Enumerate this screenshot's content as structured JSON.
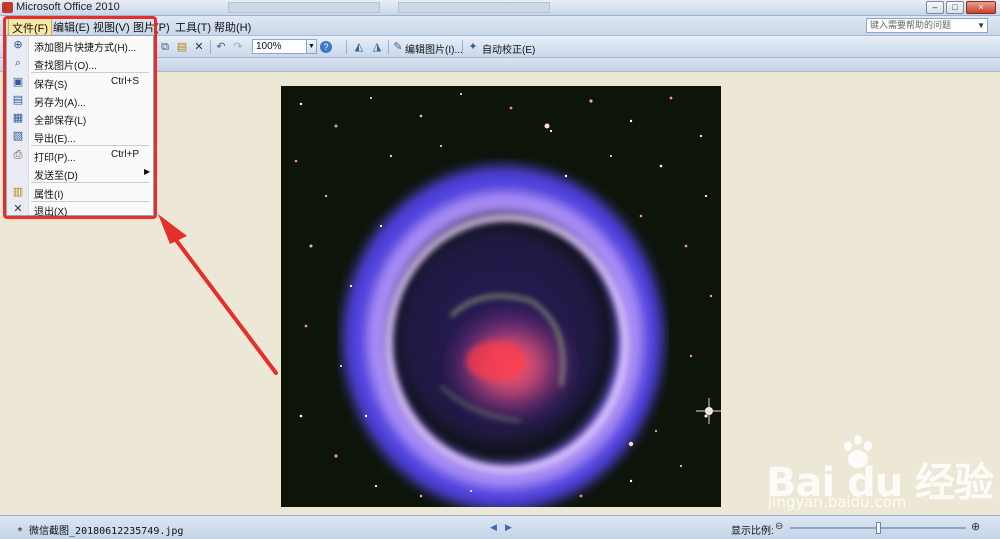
{
  "window": {
    "title": "Microsoft Office 2010",
    "background_tabs": [
      "",
      ""
    ],
    "controls": {
      "minimize": "–",
      "maximize": "□",
      "close": "×"
    }
  },
  "menubar": {
    "items": [
      "文件(F)",
      "编辑(E)",
      "视图(V)",
      "图片(P)",
      "工具(T)",
      "帮助(H)"
    ],
    "active_index": 0,
    "help_placeholder": "键入需要帮助的问题"
  },
  "toolbar": {
    "zoom_value": "100%",
    "edit_picture_label": "编辑图片(I)...",
    "auto_correct_label": "自动校正(E)"
  },
  "file_menu": {
    "items": [
      {
        "label": "添加图片快捷方式(H)...",
        "shortcut": "",
        "icon": "add-shortcut-icon"
      },
      {
        "label": "查找图片(O)...",
        "shortcut": "",
        "icon": "find-picture-icon"
      },
      {
        "label": "保存(S)",
        "shortcut": "Ctrl+S",
        "icon": "save-icon"
      },
      {
        "label": "另存为(A)...",
        "shortcut": "",
        "icon": "save-as-icon"
      },
      {
        "label": "全部保存(L)",
        "shortcut": "",
        "icon": "save-all-icon"
      },
      {
        "label": "导出(E)...",
        "shortcut": "",
        "icon": "export-icon"
      },
      {
        "label": "打印(P)...",
        "shortcut": "Ctrl+P",
        "icon": "print-icon"
      },
      {
        "label": "发送至(D)",
        "shortcut": "",
        "icon": "",
        "submenu": true
      },
      {
        "label": "属性(I)",
        "shortcut": "",
        "icon": "properties-icon"
      },
      {
        "label": "退出(X)",
        "shortcut": "",
        "icon": "exit-icon"
      }
    ]
  },
  "statusbar": {
    "filename": "* 微信截图_20180612235749.jpg",
    "zoom_label": "显示比例:",
    "zoom_level": 0.5
  },
  "watermark": {
    "main": "Bai du 经验",
    "sub": "jingyan.baidu.com"
  },
  "colors": {
    "highlight": "#e3302b",
    "menu_active": "#fbe7a5"
  }
}
